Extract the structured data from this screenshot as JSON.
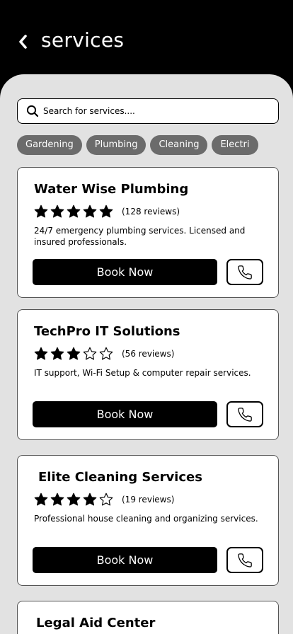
{
  "header": {
    "title": "services",
    "back_icon": "chevron-left-icon"
  },
  "search": {
    "placeholder": "Search for services....",
    "icon": "search-icon"
  },
  "categories": [
    "Gardening",
    "Plumbing",
    "Cleaning",
    "Electri"
  ],
  "cards": [
    {
      "name": "Water Wise Plumbing",
      "rating": 5,
      "reviews": "(128 reviews)",
      "description": "24/7 emergency plumbing services. Licensed and insured professionals.",
      "book_label": "Book Now",
      "call_icon": "phone-icon"
    },
    {
      "name": "TechPro IT Solutions",
      "rating": 3,
      "reviews": "(56 reviews)",
      "description": "IT support, Wi-Fi Setup & computer repair services.",
      "book_label": "Book Now",
      "call_icon": "phone-icon"
    },
    {
      "name": "Elite Cleaning Services",
      "rating": 4,
      "reviews": "(19 reviews)",
      "description": "Professional house cleaning and organizing services.",
      "book_label": "Book Now",
      "call_icon": "phone-icon"
    },
    {
      "name": "Legal Aid Center"
    }
  ],
  "colors": {
    "header_bg": "#000000",
    "sheet_bg": "#e2e2e2",
    "chip_bg": "#6b6b6b",
    "button_bg": "#000000"
  }
}
